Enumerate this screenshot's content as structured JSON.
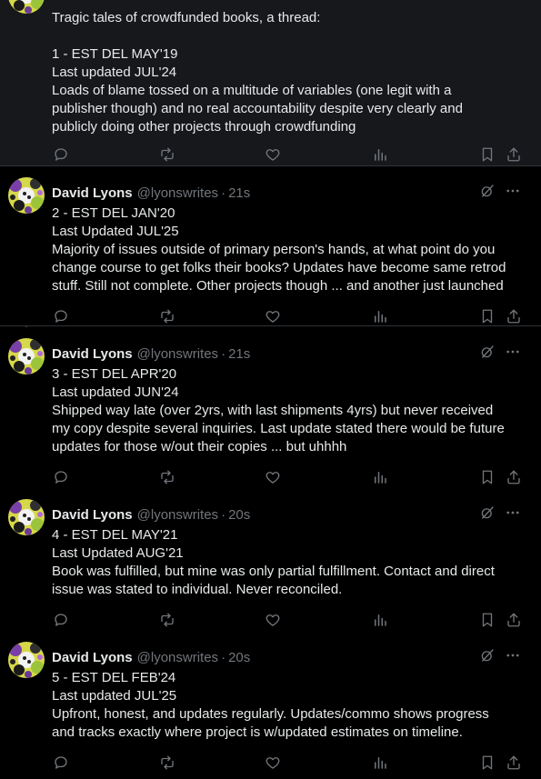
{
  "colors": {
    "background": "#000000",
    "highlight_post": "#16181c",
    "text": "#e7e9ea",
    "muted": "#71767b",
    "divider": "#2f3336"
  },
  "posts": [
    {
      "name": "",
      "handle": "",
      "time": "",
      "lines": [
        "Tragic tales of crowdfunded books, a thread:",
        "",
        "1 - EST DEL MAY'19",
        "Last updated JUL'24",
        "Loads of blame tossed on a multitude of variables (one legit with a",
        "publisher though) and no real accountability despite very clearly and",
        "publicly doing other projects through crowdfunding"
      ]
    },
    {
      "name": "David Lyons",
      "handle": "@lyonswrites",
      "time": "21s",
      "lines": [
        "2 - EST DEL JAN'20",
        "Last Updated JUL'25",
        "Majority of issues outside of primary person's hands, at what point do you",
        "change course to get folks their books? Updates have become same retrod",
        "stuff. Still not complete. Other projects though ... and another just launched"
      ]
    },
    {
      "name": "David Lyons",
      "handle": "@lyonswrites",
      "time": "21s",
      "lines": [
        "3 - EST DEL APR'20",
        "Last updated JUN'24",
        "Shipped way late (over 2yrs, with last shipments 4yrs) but never received",
        "my copy despite several inquiries. Last update stated there would be future",
        "updates for those w/out their copies ... but uhhhh"
      ]
    },
    {
      "name": "David Lyons",
      "handle": "@lyonswrites",
      "time": "20s",
      "lines": [
        "4 - EST DEL MAY'21",
        "Last Updated AUG'21",
        "Book was fulfilled, but mine was only partial fulfillment. Contact and direct",
        "issue was stated to individual. Never reconciled."
      ]
    },
    {
      "name": "David Lyons",
      "handle": "@lyonswrites",
      "time": "20s",
      "lines": [
        "5 - EST DEL FEB'24",
        "Last updated JUL'25",
        "Upfront, honest, and updates regularly. Updates/commo shows progress",
        "and tracks exactly where project is w/updated estimates on timeline."
      ]
    }
  ],
  "icons": {
    "reply": "reply-icon",
    "repost": "repost-icon",
    "like": "like-icon",
    "views": "views-icon",
    "bookmark": "bookmark-icon",
    "share": "share-icon",
    "grok": "grok-icon",
    "more": "more-icon"
  }
}
